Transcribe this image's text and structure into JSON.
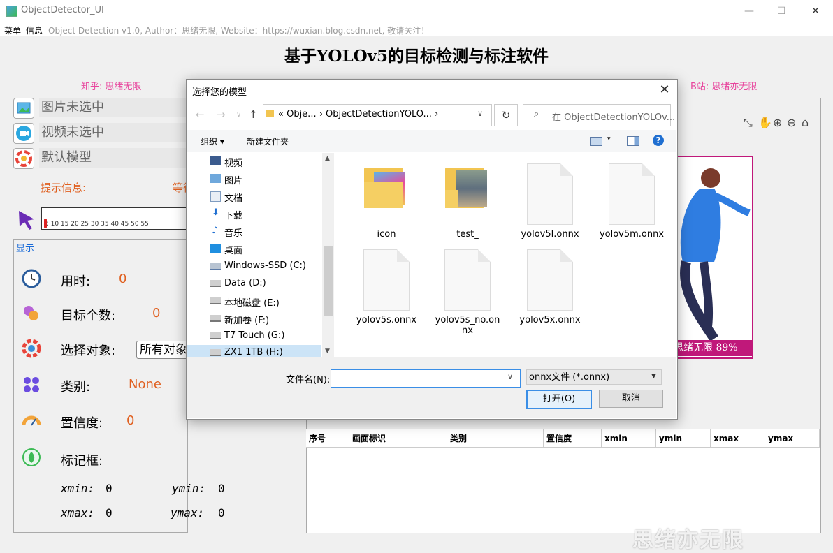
{
  "window": {
    "title": "ObjectDetector_UI",
    "minimize": "—",
    "maximize": "☐",
    "close": "✕"
  },
  "menu": {
    "items": [
      "菜单",
      "信息"
    ],
    "info_text": "Object Detection v1.0, Author：思绪无限, Website：https://wuxian.blog.csdn.net, 敬请关注！"
  },
  "main_title": "基于YOLOv5的目标检测与标注软件",
  "links": {
    "zhihu": "知乎: 思绪无限",
    "bilibili": "B站: 思绪亦无限"
  },
  "left_panel": {
    "image_select": "图片未选中",
    "video_select": "视频未选中",
    "model_select": "默认模型",
    "prompt_label": "提示信息:",
    "prompt_value": "等待",
    "slider_ticks": "5 10 15 20 25 30 35 40 45 50 55",
    "slider_value": 0
  },
  "display": {
    "group_title": "显示",
    "time_label": "用时:",
    "time_value": "0",
    "count_label": "目标个数:",
    "count_value": "0",
    "object_label": "选择对象:",
    "object_value": "所有对象",
    "class_label": "类别:",
    "class_value": "None",
    "conf_label": "置信度:",
    "conf_value": "0",
    "box_label": "标记框:",
    "xmin_label": "xmin:",
    "xmin_value": "0",
    "ymin_label": "ymin:",
    "ymin_value": "0",
    "xmax_label": "xmax:",
    "xmax_value": "0",
    "ymax_label": "ymax:",
    "ymax_value": "0"
  },
  "image_tools": [
    "pan-icon",
    "hand-icon",
    "zoom-in-icon",
    "zoom-out-icon",
    "home-icon"
  ],
  "detection_label": "思绪无限 89%",
  "table": {
    "headers": [
      "序号",
      "画面标识",
      "类别",
      "置信度",
      "xmin",
      "ymin",
      "xmax",
      "ymax"
    ]
  },
  "watermark": "思绪亦无限",
  "dialog": {
    "title": "选择您的模型",
    "close": "✕",
    "address": "« Obje... › ObjectDetectionYOLO... ›",
    "search_placeholder": "在 ObjectDetectionYOLOv...",
    "organize": "组织 ▾",
    "new_folder": "新建文件夹",
    "help": "?",
    "nav_items": [
      "视频",
      "图片",
      "文档",
      "下载",
      "音乐",
      "桌面",
      "Windows-SSD (C:)",
      "Data (D:)",
      "本地磁盘 (E:)",
      "新加卷 (F:)",
      "T7 Touch (G:)",
      "ZX1 1TB (H:)"
    ],
    "files": [
      "icon",
      "test_",
      "yolov5l.onnx",
      "yolov5m.onnx",
      "yolov5s.onnx",
      "yolov5s_no.onnx",
      "yolov5x.onnx"
    ],
    "filename_label": "文件名(N):",
    "filename_value": "",
    "filetype": "onnx文件 (*.onnx)",
    "open_button": "打开(O)",
    "cancel_button": "取消"
  }
}
